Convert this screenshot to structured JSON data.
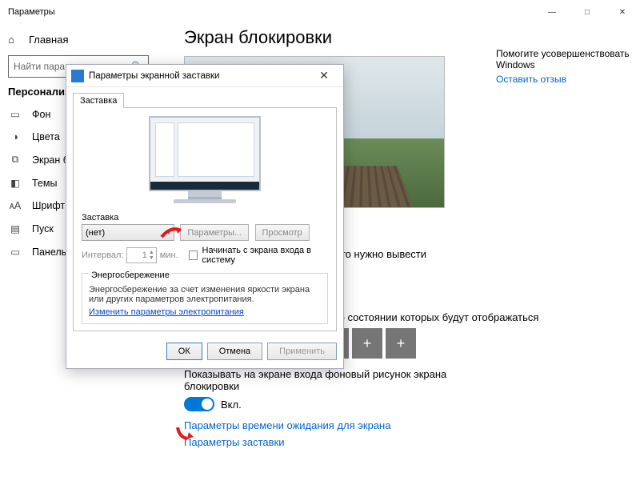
{
  "window": {
    "title": "Параметры"
  },
  "titlebar_buttons": {
    "minimize": "—",
    "maximize": "□",
    "close": "✕"
  },
  "sidebar": {
    "home": "Главная",
    "search_placeholder": "Найти параметр",
    "section": "Персонализация",
    "items": [
      {
        "icon": "image-icon",
        "glyph": "▭",
        "label": "Фон"
      },
      {
        "icon": "palette-icon",
        "glyph": "◑",
        "label": "Цвета"
      },
      {
        "icon": "lockscreen-icon",
        "glyph": "⧉",
        "label": "Экран блокировки"
      },
      {
        "icon": "themes-icon",
        "glyph": "◧",
        "label": "Темы"
      },
      {
        "icon": "fonts-icon",
        "glyph": "ᴀA",
        "label": "Шрифты"
      },
      {
        "icon": "start-icon",
        "glyph": "▤",
        "label": "Пуск"
      },
      {
        "icon": "taskbar-icon",
        "glyph": "▭",
        "label": "Панель задач"
      }
    ]
  },
  "main": {
    "heading": "Экран блокировки",
    "choose_apps_partial": "ого нужно вывести",
    "status_apps_text": "ведения о состоянии которых будут отображаться",
    "toggle_section_text": "Показывать на экране входа фоновый рисунок экрана блокировки",
    "toggle_state": "Вкл.",
    "link_timeout": "Параметры времени ожидания для экрана",
    "link_screensaver": "Параметры заставки"
  },
  "right": {
    "help_partial": "Помогите усовершенствовать Windows",
    "feedback": "Оставить отзыв"
  },
  "app_tiles": [
    "✉",
    "▦",
    "Ⓢ",
    "+",
    "+",
    "+",
    "+"
  ],
  "dialog": {
    "title": "Параметры экранной заставки",
    "tab": "Заставка",
    "screensaver_label": "Заставка",
    "combo_value": "(нет)",
    "btn_settings": "Параметры...",
    "btn_preview": "Просмотр",
    "interval_label": "Интервал:",
    "interval_value": "1",
    "interval_unit": "мин.",
    "checkbox_label": "Начинать с экрана входа в систему",
    "group_title": "Энергосбережение",
    "group_text": "Энергосбережение за счет изменения яркости экрана или других параметров электропитания.",
    "group_link": "Изменить параметры электропитания",
    "ok": "ОК",
    "cancel": "Отмена",
    "apply": "Применить"
  }
}
